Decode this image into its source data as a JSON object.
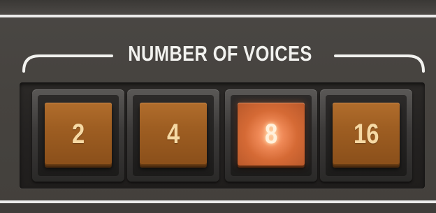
{
  "section": {
    "title": "NUMBER OF VOICES"
  },
  "voice_buttons": [
    {
      "label": "2",
      "active": false
    },
    {
      "label": "4",
      "active": false
    },
    {
      "label": "8",
      "active": true
    },
    {
      "label": "16",
      "active": false
    }
  ],
  "colors": {
    "panel": "#46433f",
    "key": "#9e5e22",
    "key_active": "#f08a58",
    "label_text": "#f6d9a4",
    "title_text": "#f2f2ef"
  }
}
